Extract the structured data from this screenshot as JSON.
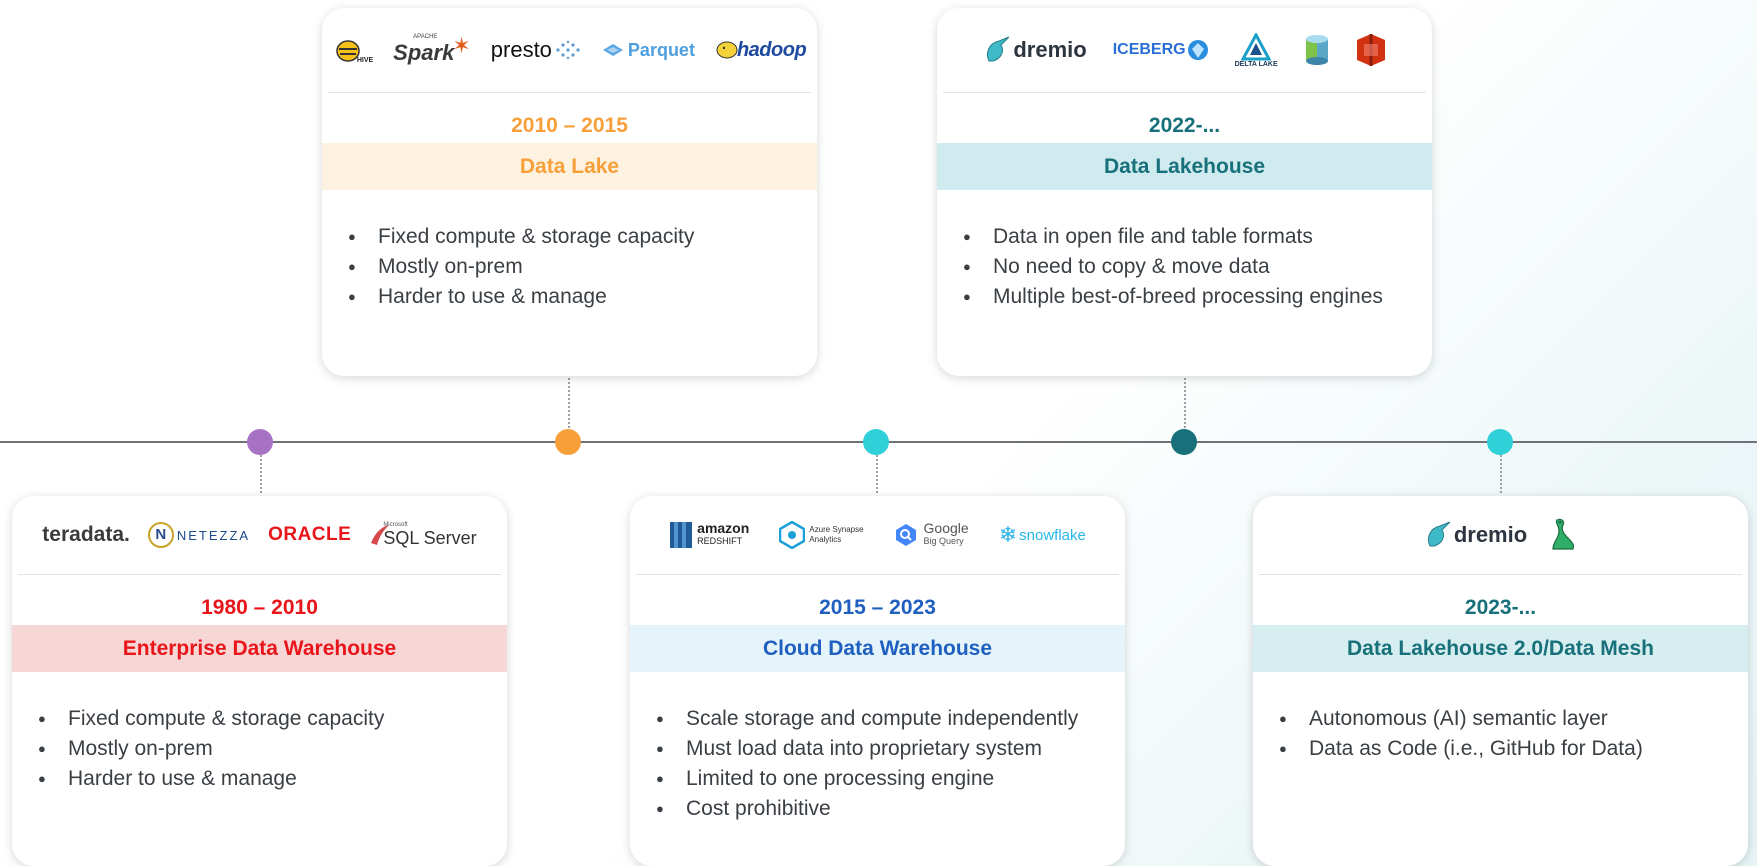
{
  "colors": {
    "edw": "#e8161a",
    "edw_band": "#f7d6d6",
    "lake": "#f7a03a",
    "lake_band": "#fdf1e0",
    "cdw": "#1f5fbf",
    "cdw_band": "#e5f4fb",
    "lakehouse": "#17707a",
    "lakehouse_band": "#d0ebef",
    "lakehouse2": "#17707a",
    "lakehouse2_band": "#d6eef0",
    "dot_purple": "#a772c4",
    "dot_orange": "#f7a03a",
    "dot_cyan": "#2fd0d8",
    "dot_teal": "#17707a"
  },
  "cards": {
    "edw": {
      "period": "1980 – 2010",
      "title": "Enterprise Data Warehouse",
      "logos": [
        "teradata.",
        "NETEZZA",
        "ORACLE",
        "SQL Server"
      ],
      "logo_extra": {
        "microsoft": "Microsoft",
        "n": "N"
      },
      "bullets": [
        "Fixed compute & storage capacity",
        "Mostly on-prem",
        "Harder to use & manage"
      ]
    },
    "lake": {
      "period": "2010 – 2015",
      "title": "Data Lake",
      "logos": [
        "HIVE",
        "Spark",
        "presto",
        "Parquet",
        "hadoop"
      ],
      "logo_extra": {
        "apache": "APACHE"
      },
      "bullets": [
        "Fixed compute & storage capacity",
        "Mostly on-prem",
        "Harder to use & manage"
      ]
    },
    "cdw": {
      "period": "2015 – 2023",
      "title": "Cloud Data Warehouse",
      "logos": [
        "amazon",
        "REDSHIFT",
        "Azure Synapse",
        "Analytics",
        "Google",
        "Big Query",
        "snowflake"
      ],
      "bullets": [
        "Scale storage and compute independently",
        "Must load data into proprietary system",
        "Limited to one processing engine",
        "Cost prohibitive"
      ]
    },
    "lakehouse": {
      "period": "2022-...",
      "title": "Data Lakehouse",
      "logos": [
        "dremio",
        "ICEBERG",
        "DELTA LAKE"
      ],
      "bullets": [
        "Data in open file and table formats",
        "No need to copy & move data",
        "Multiple best-of-breed processing engines"
      ]
    },
    "lakehouse2": {
      "period": "2023-...",
      "title": "Data Lakehouse 2.0/Data Mesh",
      "logos": [
        "dremio"
      ],
      "bullets": [
        "Autonomous (AI) semantic layer",
        "Data as Code (i.e., GitHub for Data)"
      ]
    }
  }
}
